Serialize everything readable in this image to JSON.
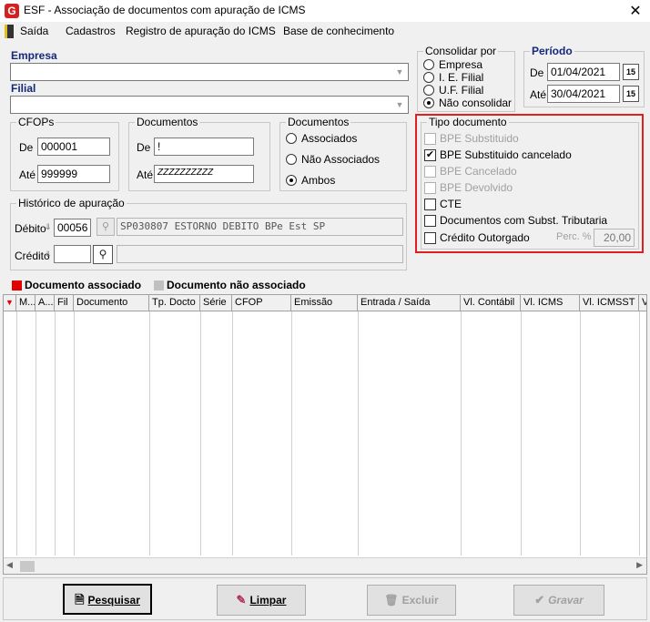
{
  "window": {
    "title": "ESF - Associação de documentos com apuração de ICMS",
    "logo": "G"
  },
  "menu": {
    "items": [
      "Saída",
      "Cadastros",
      "Registro de apuração do ICMS",
      "Base de conhecimento"
    ]
  },
  "empresa": {
    "label": "Empresa",
    "value": ""
  },
  "filial": {
    "label": "Filial",
    "value": ""
  },
  "consolidar": {
    "title": "Consolidar por",
    "options": [
      "Empresa",
      "I. E. Filial",
      "U.F. Filial",
      "Não consolidar"
    ],
    "selected": "Não consolidar"
  },
  "periodo": {
    "title": "Período",
    "de_label": "De",
    "de_value": "01/04/2021",
    "ate_label": "Até",
    "ate_value": "30/04/2021",
    "cal_icon": "15"
  },
  "cfops": {
    "title": "CFOPs",
    "de_label": "De",
    "de_value": "000001",
    "ate_label": "Até",
    "ate_value": "999999"
  },
  "documentos": {
    "title": "Documentos",
    "de_label": "De",
    "de_value": "!",
    "ate_label": "Até",
    "ate_value": "ZZZZZZZZZZ"
  },
  "documentos_filtro": {
    "title": "Documentos",
    "options": [
      "Associados",
      "Não Associados",
      "Ambos"
    ],
    "selected": "Ambos"
  },
  "tipo_documento": {
    "title": "Tipo documento",
    "items": [
      {
        "label": "BPE Substituido",
        "checked": false,
        "enabled": false
      },
      {
        "label": "BPE Substituido cancelado",
        "checked": true,
        "enabled": true
      },
      {
        "label": "BPE Cancelado",
        "checked": false,
        "enabled": false
      },
      {
        "label": "BPE Devolvido",
        "checked": false,
        "enabled": false
      },
      {
        "label": "CTE",
        "checked": false,
        "enabled": true
      },
      {
        "label": "Documentos com Subst. Tributaria",
        "checked": false,
        "enabled": true
      },
      {
        "label": "Crédito Outorgado",
        "checked": false,
        "enabled": true
      }
    ],
    "perc_label": "Perc. %",
    "perc_value": "20,00"
  },
  "historico": {
    "title": "Histórico de apuração",
    "debito_label": "Débito",
    "debito_code": "00056",
    "debito_desc": "SP030807 ESTORNO DEBITO BPe Est SP",
    "credito_label": "Crédito",
    "credito_code": "",
    "credito_desc": ""
  },
  "legend": {
    "associado": "Documento associado",
    "nao_associado": "Documento não associado",
    "associado_color": "#e00000",
    "nao_associado_color": "#c0c0c0"
  },
  "grid": {
    "columns": [
      "M...",
      "A...",
      "Fil",
      "Documento",
      "Tp. Docto",
      "Série",
      "CFOP",
      "Emissão",
      "Entrada / Saída",
      "Vl. Contábil",
      "Vl. ICMS",
      "Vl. ICMSST",
      "V"
    ]
  },
  "buttons": {
    "pesquisar": "Pesquisar",
    "limpar": "Limpar",
    "excluir": "Excluir",
    "gravar": "Gravar"
  },
  "colors": {
    "highlight_border": "#e02020",
    "label_blue": "#14287a"
  }
}
